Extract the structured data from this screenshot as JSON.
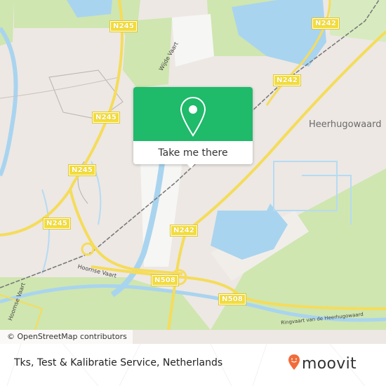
{
  "map": {
    "road_labels": [
      {
        "id": "n245-top",
        "text": "N245"
      },
      {
        "id": "n245-mid",
        "text": "N245"
      },
      {
        "id": "n245-lower",
        "text": "N245"
      },
      {
        "id": "n245-left",
        "text": "N245"
      },
      {
        "id": "n242-top",
        "text": "N242"
      },
      {
        "id": "n242-mid",
        "text": "N242"
      },
      {
        "id": "n242-center",
        "text": "N242"
      },
      {
        "id": "n508-left",
        "text": "N508"
      },
      {
        "id": "n508-right",
        "text": "N508"
      }
    ],
    "place_labels": [
      {
        "id": "heerhugowaard",
        "text": "Heerhugowaard"
      }
    ],
    "water_labels": [
      {
        "id": "wijde-vaart",
        "text": "Wijde Vaart"
      },
      {
        "id": "hoornse-vaart",
        "text": "Hoornse Vaart"
      },
      {
        "id": "hoornse-vaart-2",
        "text": "Hoornse Vaart"
      },
      {
        "id": "ringvaart",
        "text": "Ringvaart van de Heerhugowaard"
      }
    ],
    "attribution": "© OpenStreetMap contributors",
    "colors": {
      "land": "#ede8e4",
      "green": "#c9e3a8",
      "water": "#a9d4ef",
      "road": "#f5dc5a",
      "rail": "#777777"
    }
  },
  "popup": {
    "icon": "map-pin-icon",
    "button_label": "Take me there",
    "color": "#1fba6a"
  },
  "footer": {
    "title": "Tks, Test & Kalibratie Service, Netherlands",
    "brand": "moovit",
    "brand_icon": "moovit-pin-icon",
    "brand_color": "#f26b3a"
  }
}
